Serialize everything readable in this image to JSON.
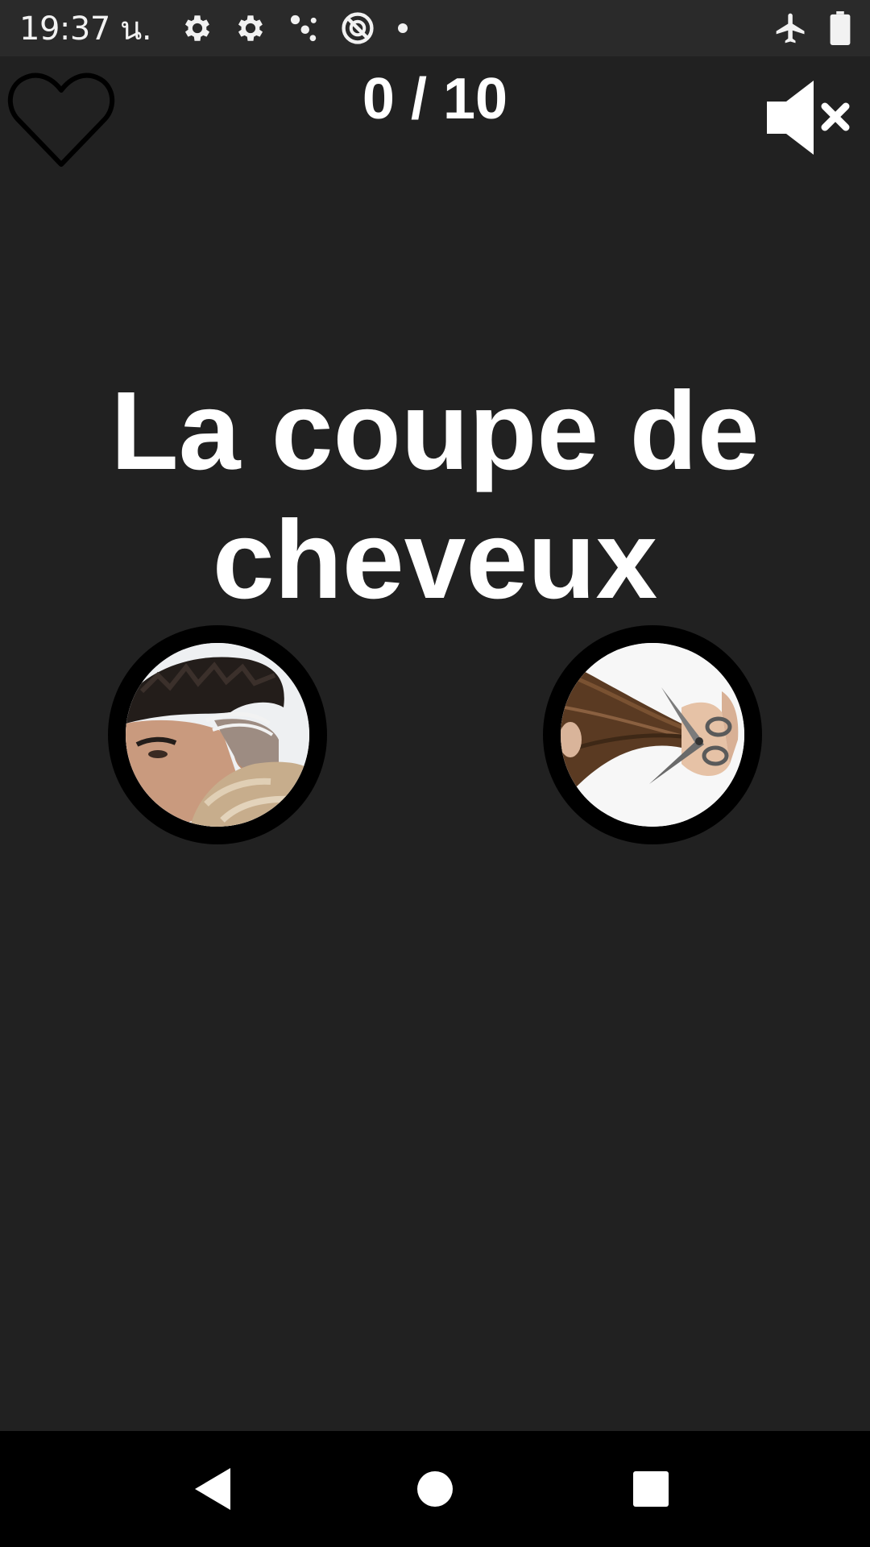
{
  "status_bar": {
    "time": "19:37 น.",
    "left_icons": [
      "settings-gear-icon",
      "settings-gear-icon",
      "dots-cluster-icon",
      "data-saver-icon",
      "notification-dot-icon"
    ],
    "right_icons": [
      "airplane-mode-icon",
      "battery-icon"
    ]
  },
  "header": {
    "favorite_icon": "heart-outline-icon",
    "score": "0 / 10",
    "sound_icon": "volume-mute-icon"
  },
  "question": {
    "text": "La coupe de cheveux"
  },
  "options": [
    {
      "image": "man-haircut-photo"
    },
    {
      "image": "scissors-cutting-hair-photo"
    }
  ],
  "nav_bar": {
    "buttons": [
      "back-triangle-icon",
      "home-circle-icon",
      "recents-square-icon"
    ]
  },
  "colors": {
    "background": "#212121",
    "status_bar": "#2a2a2a",
    "nav_bar": "#000000",
    "text": "#ffffff",
    "option_ring": "#000000"
  }
}
